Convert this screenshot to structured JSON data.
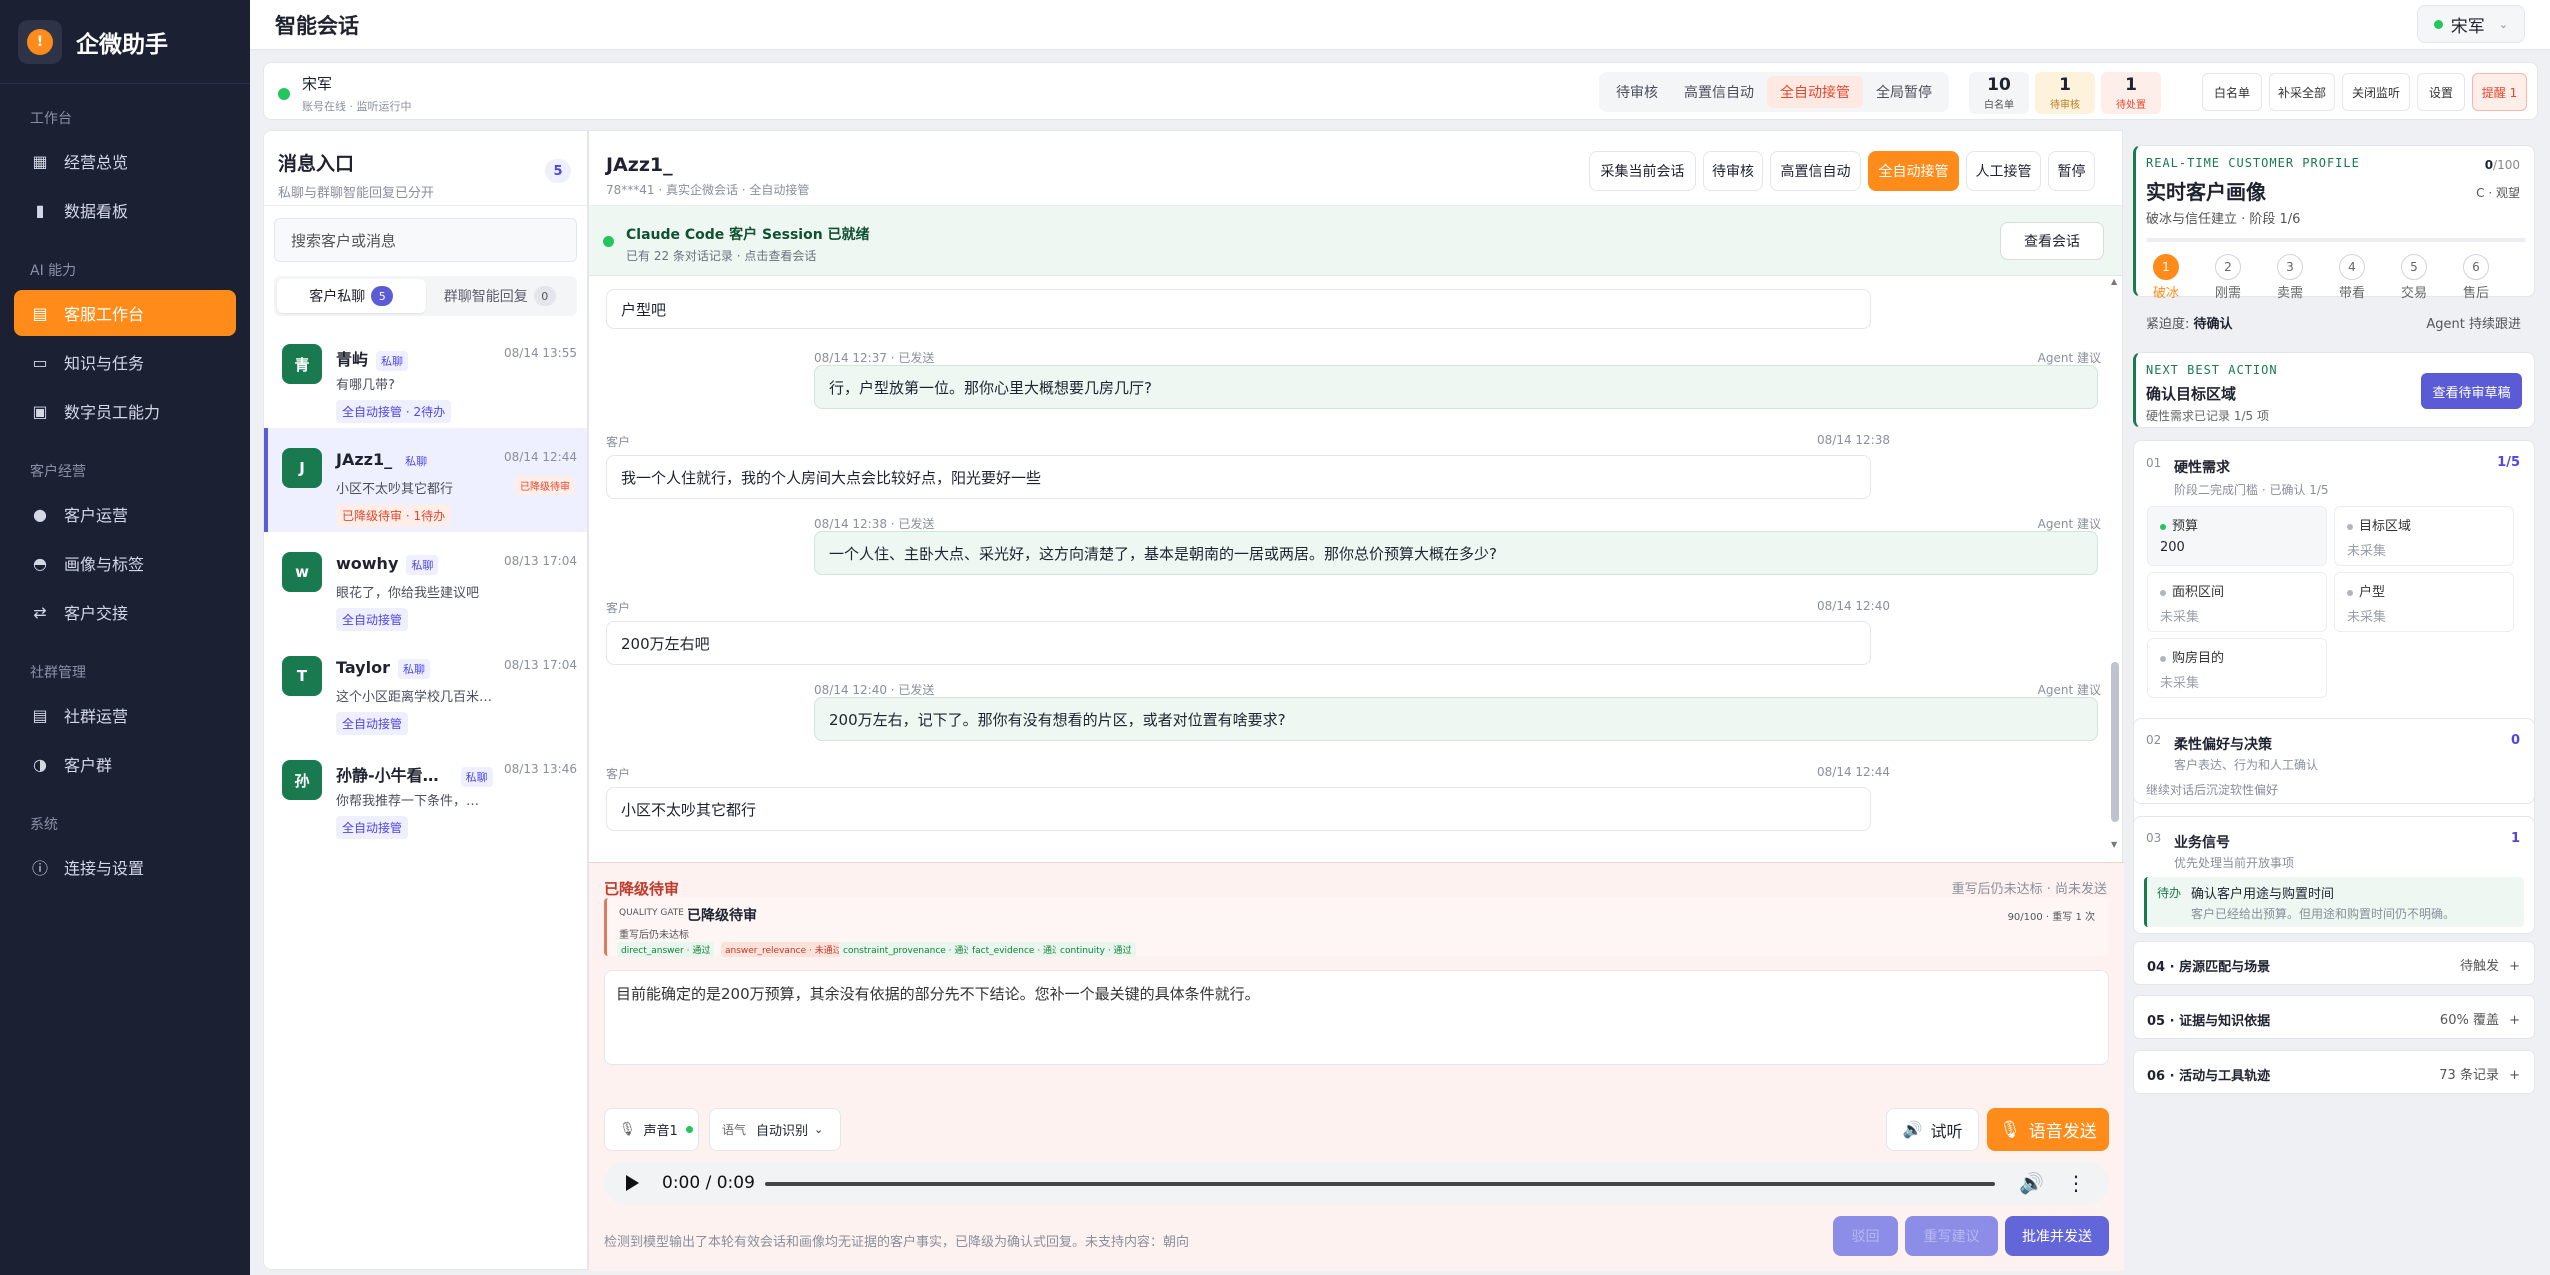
{
  "sidebar": {
    "brand": "企微助手",
    "groups": [
      {
        "title": "工作台",
        "items": [
          {
            "label": "经营总览",
            "icon": "grid-icon"
          },
          {
            "label": "数据看板",
            "icon": "bar-chart-icon"
          }
        ]
      },
      {
        "title": "AI 能力",
        "items": [
          {
            "label": "客服工作台",
            "icon": "chat-icon"
          },
          {
            "label": "知识与任务",
            "icon": "folder-icon"
          },
          {
            "label": "数字员工能力",
            "icon": "robot-icon"
          }
        ]
      },
      {
        "title": "客户经营",
        "items": [
          {
            "label": "客户运营",
            "icon": "user-add-icon"
          },
          {
            "label": "画像与标签",
            "icon": "person-icon"
          },
          {
            "label": "客户交接",
            "icon": "transfer-icon"
          }
        ]
      },
      {
        "title": "社群管理",
        "items": [
          {
            "label": "社群运营",
            "icon": "document-icon"
          },
          {
            "label": "客户群",
            "icon": "group-icon"
          }
        ]
      },
      {
        "title": "系统",
        "items": [
          {
            "label": "连接与设置",
            "icon": "info-icon"
          }
        ]
      }
    ]
  },
  "topbar": {
    "title": "智能会话",
    "user": "宋军"
  },
  "statusbar": {
    "name": "宋军",
    "sub": "账号在线 · 监听运行中",
    "modes": [
      "待审核",
      "高置信自动",
      "全自动接管",
      "全局暂停"
    ],
    "stats": [
      {
        "num": "10",
        "label": "白名单"
      },
      {
        "num": "1",
        "label": "待审核"
      },
      {
        "num": "1",
        "label": "待处置"
      }
    ],
    "buttons": [
      "白名单",
      "补采全部",
      "关闭监听",
      "设置",
      "提醒 1"
    ]
  },
  "inbox": {
    "title": "消息入口",
    "sub": "私聊与群聊智能回复已分开",
    "count": "5",
    "search_placeholder": "搜索客户或消息",
    "tabs": [
      {
        "label": "客户私聊",
        "count": "5"
      },
      {
        "label": "群聊智能回复",
        "count": "0"
      }
    ],
    "private_tag": "私聊",
    "conversations": [
      {
        "avatar": "青",
        "name": "青屿",
        "time": "08/14 13:55",
        "msg": "有哪几带?",
        "status": "全自动接管 · 2待办"
      },
      {
        "avatar": "J",
        "name": "JAzz1_",
        "time": "08/14 12:44",
        "msg": "小区不太吵其它都行",
        "status": "已降级待审 · 1待办",
        "flag": "已降级待审"
      },
      {
        "avatar": "w",
        "name": "wowhy",
        "time": "08/13 17:04",
        "msg": "眼花了，你给我些建议吧",
        "status": "全自动接管"
      },
      {
        "avatar": "T",
        "name": "Taylor",
        "time": "08/13 17:04",
        "msg": "这个小区距离学校几百米…",
        "status": "全自动接管"
      },
      {
        "avatar": "孙",
        "name": "孙静-小牛看…",
        "time": "08/13 13:46",
        "msg": "你帮我推荐一下条件，…",
        "status": "全自动接管"
      }
    ]
  },
  "chat": {
    "title": "JAzz1_",
    "sub": "78***41 · 真实企微会话 · 全自动接管",
    "actions": [
      "采集当前会话",
      "待审核",
      "高置信自动",
      "全自动接管",
      "人工接管",
      "暂停"
    ],
    "session_title": "Claude Code 客户 Session 已就绪",
    "session_sub": "已有 22 条对话记录 · 点击查看会话",
    "session_btn": "查看会话",
    "messages": [
      {
        "role": "customer",
        "meta": "",
        "text": "户型吧"
      },
      {
        "role": "agent",
        "meta": "08/14 12:37 · 已发送",
        "hint": "Agent 建议",
        "text": "行，户型放第一位。那你心里大概想要几房几厅?"
      },
      {
        "role": "customer",
        "meta": "客户",
        "time": "08/14 12:38",
        "text": "我一个人住就行，我的个人房间大点会比较好点，阳光要好一些"
      },
      {
        "role": "agent",
        "meta": "08/14 12:38 · 已发送",
        "hint": "Agent 建议",
        "text": "一个人住、主卧大点、采光好，这方向清楚了，基本是朝南的一居或两居。那你总价预算大概在多少?"
      },
      {
        "role": "customer",
        "meta": "客户",
        "time": "08/14 12:40",
        "text": "200万左右吧"
      },
      {
        "role": "agent",
        "meta": "08/14 12:40 · 已发送",
        "hint": "Agent 建议",
        "text": "200万左右，记下了。那你有没有想看的片区，或者对位置有啥要求?"
      },
      {
        "role": "customer",
        "meta": "客户",
        "time": "08/14 12:44",
        "text": "小区不太吵其它都行"
      }
    ]
  },
  "review": {
    "title": "已降级待审",
    "right": "重写后仍未达标 · 尚未发送",
    "gate_label": "QUALITY GATE",
    "gate_title": "已降级待审",
    "gate_sub": "重写后仍未达标",
    "gate_score": "90/100 · 重写 1 次",
    "checks": [
      {
        "label": "direct_answer · 通过",
        "ok": true
      },
      {
        "label": "answer_relevance · 未通过",
        "ok": false
      },
      {
        "label": "constraint_provenance · 通过",
        "ok": true
      },
      {
        "label": "fact_evidence · 通过",
        "ok": true
      },
      {
        "label": "continuity · 通过",
        "ok": true
      }
    ],
    "draft": "目前能确定的是200万预算，其余没有依据的部分先不下结论。您补一个最关键的具体条件就行。",
    "voice": "声音1",
    "tone_label": "语气",
    "tone_value": "自动识别",
    "preview": "试听",
    "send_voice": "语音发送",
    "player_time": "0:00 / 0:09",
    "footer": "检测到模型输出了本轮有效会话和画像均无证据的客户事实，已降级为确认式回复。未支持内容：朝向",
    "btn1": "驳回",
    "btn2": "重写建议",
    "btn3": "批准并发送"
  },
  "profile": {
    "eyebrow": "REAL-TIME CUSTOMER PROFILE",
    "score": "0",
    "score_max": "/100",
    "title": "实时客户画像",
    "sub": "破冰与信任建立 · 阶段 1/6",
    "grade": "C · 观望",
    "steps": [
      "破冰",
      "刚需",
      "卖需",
      "带看",
      "交易",
      "售后"
    ],
    "urgency_label": "紧迫度:",
    "urgency_value": "待确认",
    "agent_status": "Agent 持续跟进"
  },
  "nba": {
    "eyebrow": "NEXT BEST ACTION",
    "title": "确认目标区域",
    "sub": "硬性需求已记录 1/5 项",
    "btn": "查看待审草稿"
  },
  "hard": {
    "num": "01",
    "title": "硬性需求",
    "sub": "阶段二完成门槛 · 已确认 1/5",
    "count": "1/5",
    "fields": [
      {
        "label": "预算",
        "value": "200",
        "filled": true
      },
      {
        "label": "目标区域",
        "value": "未采集",
        "filled": false
      },
      {
        "label": "面积区间",
        "value": "未采集",
        "filled": false
      },
      {
        "label": "户型",
        "value": "未采集",
        "filled": false
      },
      {
        "label": "购房目的",
        "value": "未采集",
        "filled": false
      }
    ]
  },
  "soft": {
    "num": "02",
    "title": "柔性偏好与决策",
    "sub": "客户表达、行为和人工确认",
    "count": "0",
    "hint": "继续对话后沉淀软性偏好"
  },
  "biz": {
    "num": "03",
    "title": "业务信号",
    "sub": "优先处理当前开放事项",
    "count": "1",
    "tag": "待办",
    "item_title": "确认客户用途与购置时间",
    "item_sub": "客户已经给出预算。但用途和购置时间仍不明确。"
  },
  "collapsed": [
    {
      "title": "04 · 房源匹配与场景",
      "right": "待触发"
    },
    {
      "title": "05 · 证据与知识依据",
      "right": "60% 覆盖"
    },
    {
      "title": "06 · 活动与工具轨迹",
      "right": "73 条记录"
    }
  ],
  "colors": {
    "accent": "#ff8c1a",
    "indigo": "#5b5bd6",
    "sidebar": "#1c2033",
    "ok": "#22c55e",
    "warn": "#e5482d"
  }
}
